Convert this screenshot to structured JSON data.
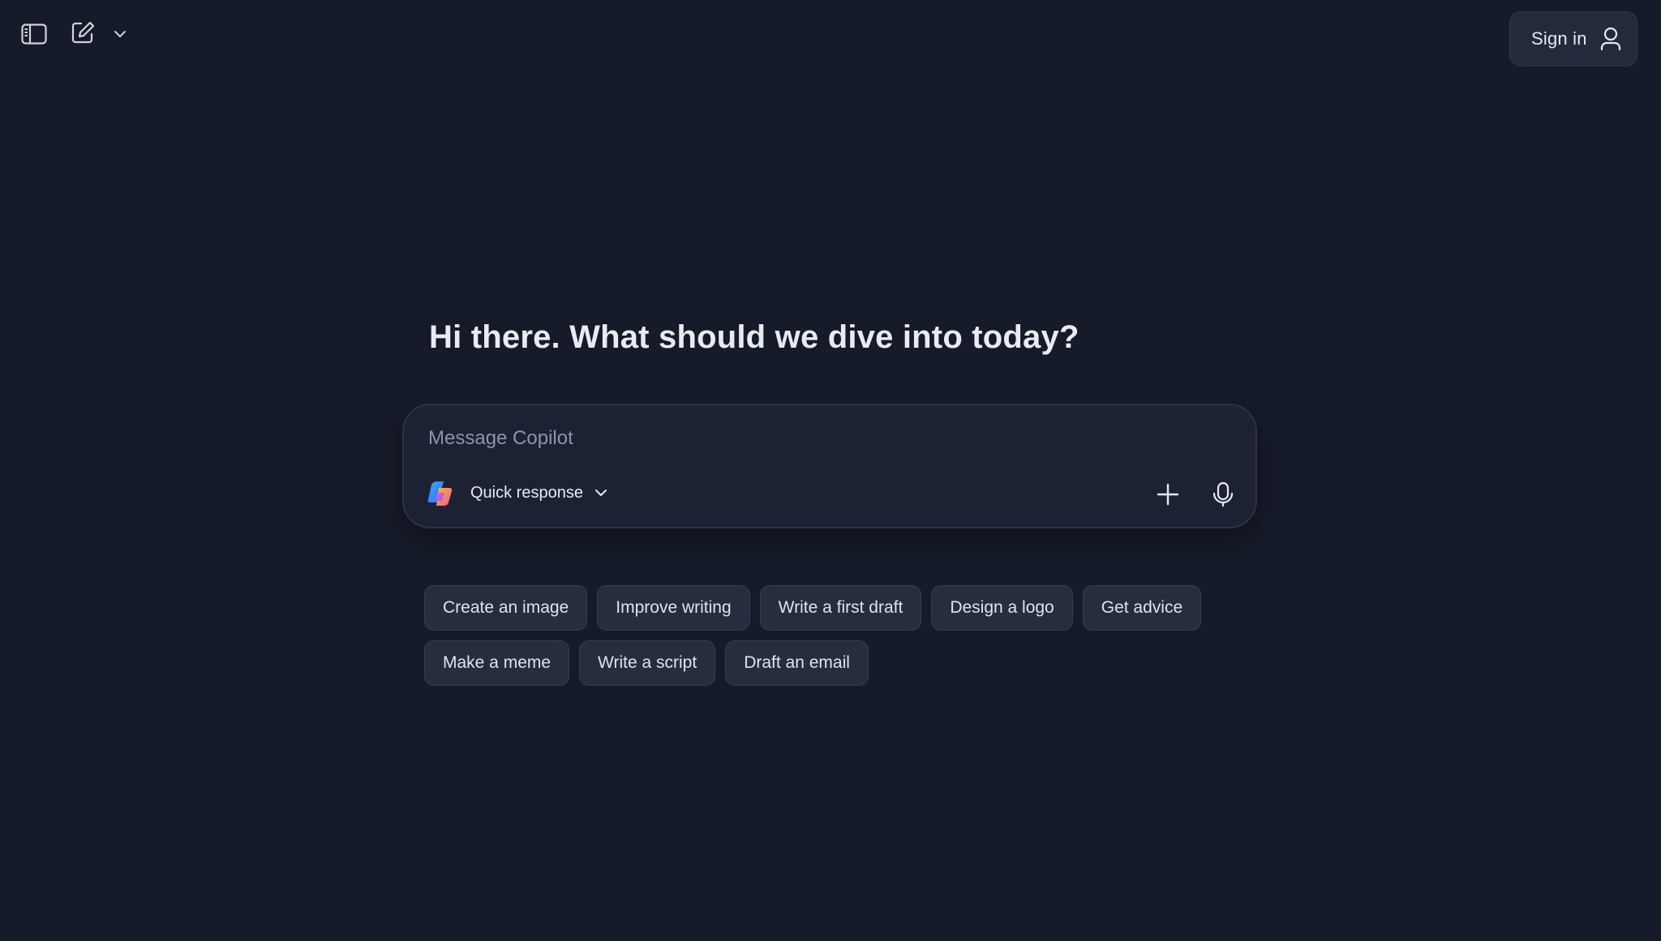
{
  "header": {
    "sidebar_toggle_icon": "sidebar-icon",
    "new_chat_icon": "new-chat-icon",
    "dropdown_icon": "chevron-down-icon",
    "sign_in_label": "Sign in",
    "sign_in_icon": "user-icon"
  },
  "main": {
    "greeting": "Hi there. What should we dive into today?"
  },
  "composer": {
    "placeholder": "Message Copilot",
    "value": "",
    "mode_label": "Quick response",
    "logo_icon": "copilot-logo-icon",
    "add_icon": "plus-icon",
    "mic_icon": "microphone-icon"
  },
  "suggestions": {
    "row1": [
      "Create an image",
      "Improve writing",
      "Write a first draft",
      "Design a logo",
      "Get advice"
    ],
    "row2": [
      "Make a meme",
      "Write a script",
      "Draft an email"
    ]
  },
  "colors": {
    "background": "#161b29",
    "composer_bg": "#1c2234",
    "chip_bg": "#262d3e",
    "text": "#e7eaf2",
    "placeholder": "#8c93a6"
  }
}
